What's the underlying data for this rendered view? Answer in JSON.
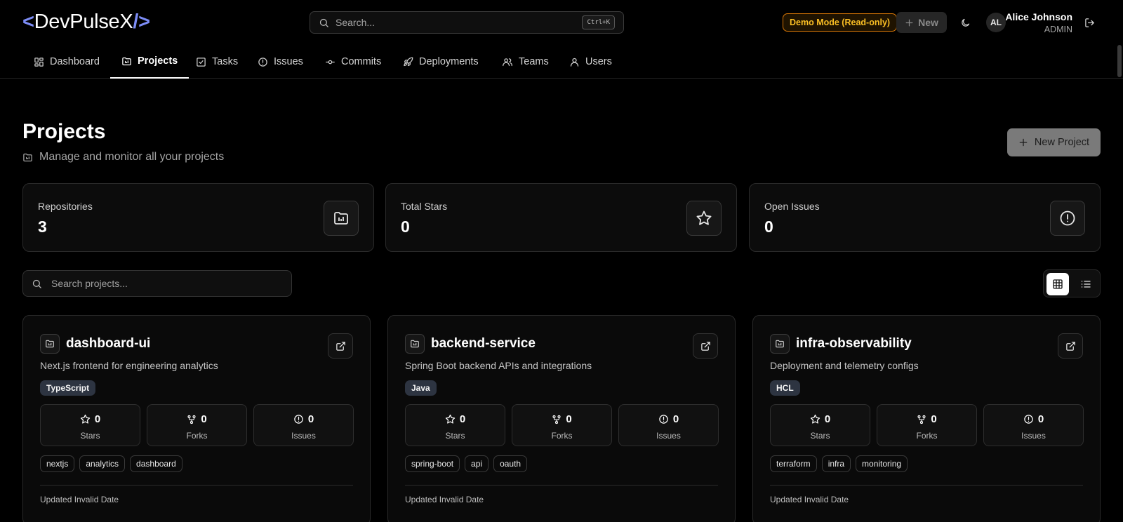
{
  "app": {
    "logo_open": "<",
    "logo_text": "DevPulseX",
    "logo_close": "/>"
  },
  "header": {
    "search_placeholder": "Search...",
    "search_shortcut": "Ctrl+K",
    "demo_badge": "Demo Mode (Read-only)",
    "new_label": "New",
    "user": {
      "initials": "AL",
      "name": "Alice Johnson",
      "role": "ADMIN"
    }
  },
  "nav": {
    "tabs": [
      {
        "label": "Dashboard",
        "icon": "dashboard-icon"
      },
      {
        "label": "Projects",
        "icon": "projects-icon",
        "active": true
      },
      {
        "label": "Tasks",
        "icon": "tasks-icon"
      },
      {
        "label": "Issues",
        "icon": "issues-icon"
      },
      {
        "label": "Commits",
        "icon": "commit-icon"
      },
      {
        "label": "Deployments",
        "icon": "rocket-icon"
      },
      {
        "label": "Teams",
        "icon": "teams-icon"
      },
      {
        "label": "Users",
        "icon": "user-icon"
      }
    ]
  },
  "page": {
    "title": "Projects",
    "subtitle": "Manage and monitor all your projects",
    "new_project_label": "New Project"
  },
  "stats": [
    {
      "label": "Repositories",
      "value": "3",
      "icon": "repo-icon"
    },
    {
      "label": "Total Stars",
      "value": "0",
      "icon": "star-icon"
    },
    {
      "label": "Open Issues",
      "value": "0",
      "icon": "alert-circle-icon"
    }
  ],
  "project_search": {
    "placeholder": "Search projects..."
  },
  "projects": [
    {
      "name": "dashboard-ui",
      "description": "Next.js frontend for engineering analytics",
      "language": "TypeScript",
      "stars": "0",
      "forks": "0",
      "issues": "0",
      "tags": [
        "nextjs",
        "analytics",
        "dashboard"
      ],
      "updated": "Updated Invalid Date"
    },
    {
      "name": "backend-service",
      "description": "Spring Boot backend APIs and integrations",
      "language": "Java",
      "stars": "0",
      "forks": "0",
      "issues": "0",
      "tags": [
        "spring-boot",
        "api",
        "oauth"
      ],
      "updated": "Updated Invalid Date"
    },
    {
      "name": "infra-observability",
      "description": "Deployment and telemetry configs",
      "language": "HCL",
      "stars": "0",
      "forks": "0",
      "issues": "0",
      "tags": [
        "terraform",
        "infra",
        "monitoring"
      ],
      "updated": "Updated Invalid Date"
    }
  ],
  "metric_labels": {
    "stars": "Stars",
    "forks": "Forks",
    "issues": "Issues"
  },
  "colors": {
    "background": "#000000",
    "accent": "#7c8cf5",
    "demo_badge": "#fbbf24",
    "language_badge": "#2d3441"
  }
}
